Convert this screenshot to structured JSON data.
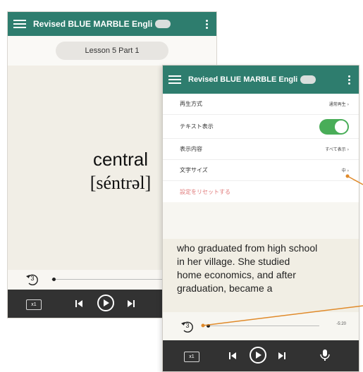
{
  "app_title": "Revised BLUE MARBLE Engli",
  "phoneA": {
    "lesson": "Lesson 5 Part 1",
    "word": "central",
    "phonetic": "[séntrəl]",
    "replay_count": "3",
    "speed": "x1"
  },
  "phoneB": {
    "settings": [
      {
        "label": "再生方式",
        "value": "通常再生 ›"
      },
      {
        "label": "テキスト表示",
        "value": ""
      },
      {
        "label": "表示内容",
        "value": "すべて表示 ›"
      },
      {
        "label": "文字サイズ",
        "value": "中 ›"
      }
    ],
    "reset_label": "設定をリセットする",
    "text_lines": [
      "who graduated from high school",
      "in her village.   She studied",
      "home economics, and after",
      "graduation, became a"
    ],
    "replay_count": "3",
    "time": "-5:20",
    "speed": "x1"
  },
  "colors": {
    "header": "#2e7d6e",
    "control_bar": "#323232",
    "toggle_on": "#49ad58",
    "callout": "#e08a2a",
    "reset_text": "#e07a7a"
  },
  "icons": [
    "hamburger-icon",
    "toggle-pill-icon",
    "more-vert-icon",
    "replay-icon",
    "skip-previous-icon",
    "play-icon",
    "skip-next-icon",
    "mic-icon"
  ]
}
